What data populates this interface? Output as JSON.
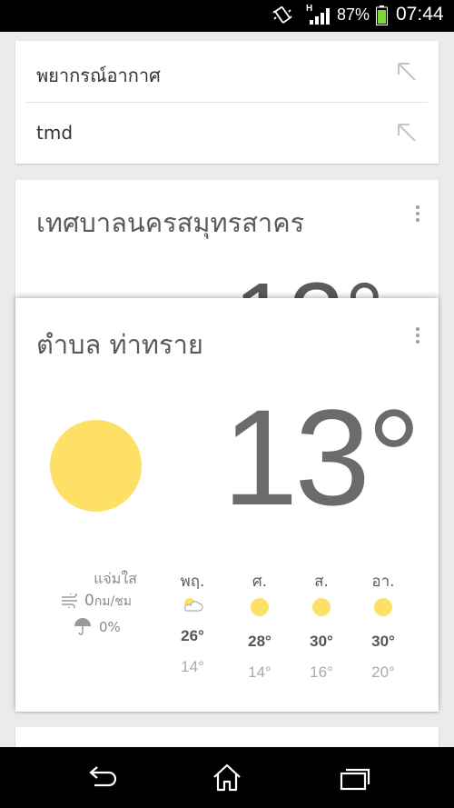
{
  "status_bar": {
    "network_type": "H",
    "battery_percent": "87%",
    "time": "07:44",
    "icons": [
      "vibrate-icon",
      "signal-icon",
      "battery-icon"
    ]
  },
  "suggestions": [
    {
      "text": "พยากรณ์อากาศ",
      "icon": "arrow-up-left-icon"
    },
    {
      "text": "tmd",
      "icon": "arrow-up-left-icon"
    }
  ],
  "location_card_1": {
    "title": "เทศบาลนครสมุทรสาคร",
    "temp_partial": "13°"
  },
  "weather": {
    "location": "ตำบล ท่าทราย",
    "current_temp": "13°",
    "condition": "แจ่มใส",
    "wind_value": "0",
    "wind_unit": "กม/ชม",
    "precip": "0%",
    "sun_color": "#ffe066",
    "forecast": [
      {
        "day": "พฤ.",
        "icon": "partly-cloudy-icon",
        "high": "26°",
        "low": "14°"
      },
      {
        "day": "ศ.",
        "icon": "sunny-icon",
        "high": "28°",
        "low": "14°"
      },
      {
        "day": "ส.",
        "icon": "sunny-icon",
        "high": "30°",
        "low": "16°"
      },
      {
        "day": "อา.",
        "icon": "sunny-icon",
        "high": "30°",
        "low": "20°"
      }
    ]
  },
  "nav_bar": [
    "back-icon",
    "home-icon",
    "recents-icon"
  ]
}
